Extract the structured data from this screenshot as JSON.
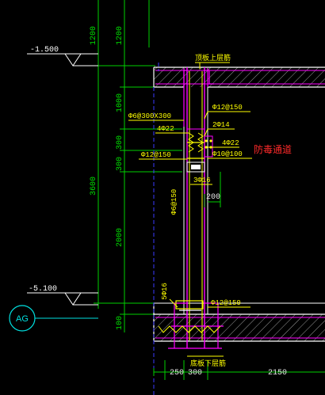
{
  "levels": {
    "top": "-1.500",
    "bottom": "-5.100"
  },
  "grid_axis": "AG",
  "vertical_dims": {
    "d1200a": "1200",
    "d1200b": "1200",
    "d1000": "1000",
    "d300a": "300",
    "d300b": "300",
    "d3600": "3600",
    "d2000": "2000",
    "d100": "100"
  },
  "horizontal_dims": {
    "d250": "250",
    "d300": "300",
    "d2150": "2150",
    "d200": "200"
  },
  "labels": {
    "top_slab": "顶板上层筋",
    "bottom_slab": "底板下层筋",
    "rebar_12_150_top": "Φ12@150",
    "rebar_6_300": "Φ6@300X300",
    "rebar_4_22_left": "4Φ22",
    "rebar_2_14": "2Φ14",
    "rebar_4_22_right": "4Φ22",
    "rebar_12_150_mid": "Φ12@150",
    "rebar_10_100": "Φ10@100",
    "rebar_3_16": "3Φ16",
    "rebar_6_150": "Φ6@150",
    "rebar_5_16": "5Φ16",
    "rebar_12_150_bottom": "Φ12@150",
    "passage": "防毒通道"
  },
  "colors": {
    "background": "#000000",
    "dimension": "#00ff00",
    "wall_concrete": "#ff00ff",
    "rebar": "#ffff00",
    "slab_outline": "#ffffff",
    "hatch": "#ffffff",
    "grid_circle": "#00ffff",
    "passage_text": "#ff2020",
    "dashed": "#3030ff"
  }
}
